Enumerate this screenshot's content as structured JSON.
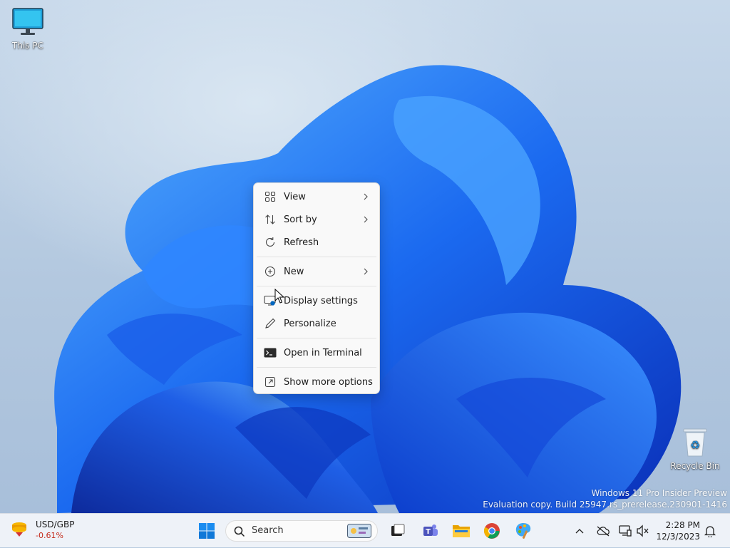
{
  "desktop": {
    "icons": [
      {
        "label": "This PC",
        "icon": "monitor-icon"
      },
      {
        "label": "Recycle Bin",
        "icon": "recycle-bin-icon"
      }
    ],
    "watermark": {
      "line1": "Windows 11 Pro Insider Preview",
      "line2": "Evaluation copy. Build 25947.rs_prerelease.230901-1416"
    }
  },
  "context_menu": {
    "items": [
      {
        "label": "View",
        "icon": "grid-view-icon",
        "submenu": true
      },
      {
        "label": "Sort by",
        "icon": "sort-icon",
        "submenu": true
      },
      {
        "label": "Refresh",
        "icon": "refresh-icon",
        "submenu": false
      },
      {
        "label": "New",
        "icon": "new-plus-icon",
        "submenu": true
      },
      {
        "label": "Display settings",
        "icon": "display-settings-icon",
        "submenu": false
      },
      {
        "label": "Personalize",
        "icon": "pen-icon",
        "submenu": false
      },
      {
        "label": "Open in Terminal",
        "icon": "terminal-icon",
        "submenu": false
      },
      {
        "label": "Show more options",
        "icon": "external-options-icon",
        "submenu": false
      }
    ]
  },
  "taskbar": {
    "widget": {
      "title": "USD/GBP",
      "change": "-0.61%",
      "icon": "currency-icon"
    },
    "search_placeholder": "Search",
    "apps": [
      "start-icon",
      "task-view-icon",
      "teams-icon",
      "file-explorer-icon",
      "chrome-icon",
      "paint-icon"
    ],
    "tray": {
      "time": "2:28 PM",
      "date": "12/3/2023"
    }
  },
  "colors": {
    "accent": "#0067c0",
    "negative": "#c42b1c",
    "menu_bg": "#f9f9f9",
    "taskbar_bg": "#eef2f8"
  }
}
